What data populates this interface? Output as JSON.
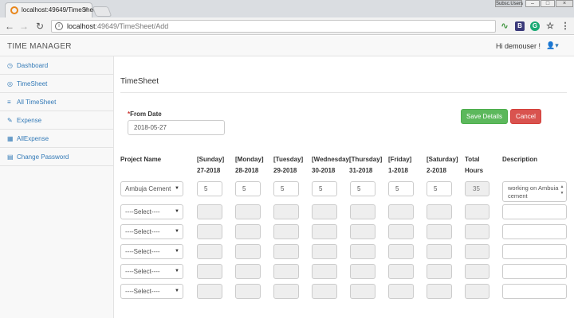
{
  "browser": {
    "tab_title": "localhost:49649/TimeSheet/",
    "tab_close": "×",
    "url_host": "localhost",
    "url_rest": ":49649/TimeSheet/Add",
    "profile": "Subsc.Users",
    "ext_b": "B",
    "ext_g": "G",
    "menu": "⋮",
    "star": "☆"
  },
  "navbar": {
    "brand": "TIME MANAGER",
    "greeting": "Hi demouser !"
  },
  "sidebar": {
    "items": [
      {
        "label": "Dashboard",
        "icon": "◷"
      },
      {
        "label": "TimeSheet",
        "icon": "◎"
      },
      {
        "label": "All TimeSheet",
        "icon": "≡"
      },
      {
        "label": "Expense",
        "icon": "✎"
      },
      {
        "label": "AllExpense",
        "icon": "▦"
      },
      {
        "label": "Change Password",
        "icon": "▤"
      }
    ]
  },
  "main": {
    "title": "TimeSheet",
    "from_date_required": "*",
    "from_date_label": "From Date",
    "from_date_value": "2018-05-27",
    "save_label": "Save Details",
    "cancel_label": "Cancel"
  },
  "columns": [
    {
      "line1": "Project Name",
      "line2": ""
    },
    {
      "line1": "[Sunday]",
      "line2": "27-2018"
    },
    {
      "line1": "[Monday]",
      "line2": "28-2018"
    },
    {
      "line1": "[Tuesday]",
      "line2": "29-2018"
    },
    {
      "line1": "[Wednesday]",
      "line2": "30-2018"
    },
    {
      "line1": "[Thursday]",
      "line2": "31-2018"
    },
    {
      "line1": "[Friday]",
      "line2": "1-2018"
    },
    {
      "line1": "[Saturday]",
      "line2": "2-2018"
    },
    {
      "line1": "Total",
      "line2": "Hours"
    },
    {
      "line1": "Description",
      "line2": ""
    }
  ],
  "rows": [
    {
      "project": "Ambuja Cement",
      "hours": [
        "5",
        "5",
        "5",
        "5",
        "5",
        "5",
        "5"
      ],
      "total": "35",
      "description": "working on Ambuia cement"
    },
    {
      "project": "----Select----",
      "hours": [
        "",
        "",
        "",
        "",
        "",
        "",
        ""
      ],
      "total": "",
      "description": ""
    },
    {
      "project": "----Select----",
      "hours": [
        "",
        "",
        "",
        "",
        "",
        "",
        ""
      ],
      "total": "",
      "description": ""
    },
    {
      "project": "----Select----",
      "hours": [
        "",
        "",
        "",
        "",
        "",
        "",
        ""
      ],
      "total": "",
      "description": ""
    },
    {
      "project": "----Select----",
      "hours": [
        "",
        "",
        "",
        "",
        "",
        "",
        ""
      ],
      "total": "",
      "description": ""
    },
    {
      "project": "----Select----",
      "hours": [
        "",
        "",
        "",
        "",
        "",
        "",
        ""
      ],
      "total": "",
      "description": ""
    }
  ],
  "colors": {
    "link": "#337ab7",
    "save": "#5cb85c",
    "cancel": "#d9534f"
  }
}
